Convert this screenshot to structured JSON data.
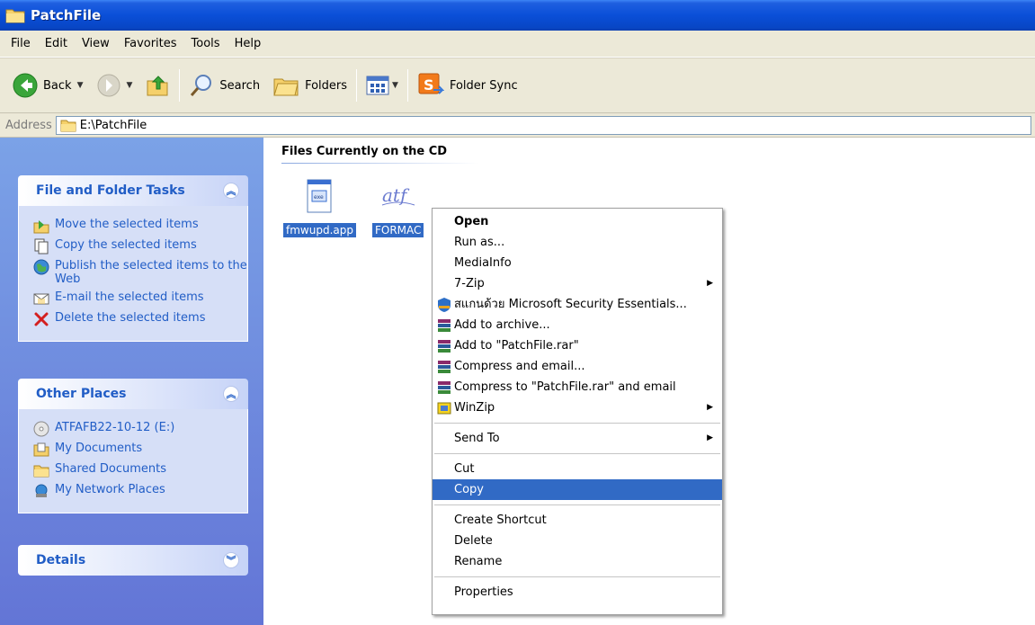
{
  "window": {
    "title": "PatchFile"
  },
  "menubar": {
    "items": [
      "File",
      "Edit",
      "View",
      "Favorites",
      "Tools",
      "Help"
    ]
  },
  "toolbar": {
    "back_label": "Back",
    "search_label": "Search",
    "folders_label": "Folders",
    "folder_sync_label": "Folder Sync"
  },
  "address": {
    "label": "Address",
    "value": "E:\\PatchFile"
  },
  "taskpane": {
    "file_tasks": {
      "title": "File and Folder Tasks",
      "items": [
        "Move the selected items",
        "Copy the selected items",
        "Publish the selected items to the Web",
        "E-mail the selected items",
        "Delete the selected items"
      ]
    },
    "other_places": {
      "title": "Other Places",
      "items": [
        "ATFAFB22-10-12 (E:)",
        "My Documents",
        "Shared Documents",
        "My Network Places"
      ]
    },
    "details": {
      "title": "Details"
    }
  },
  "content": {
    "group_title": "Files Currently on the CD",
    "files": [
      {
        "name": "fmwupd.app",
        "icon": "app-file-icon"
      },
      {
        "name": "FORMAC",
        "icon": "atf-file-icon"
      }
    ]
  },
  "context_menu": {
    "items": [
      {
        "label": "Open",
        "bold": true
      },
      {
        "label": "Run as..."
      },
      {
        "label": "MediaInfo"
      },
      {
        "label": "7-Zip",
        "submenu": true
      },
      {
        "label": "สแกนด้วย Microsoft Security Essentials...",
        "icon": "security-essentials-icon"
      },
      {
        "label": "Add to archive...",
        "icon": "winrar-icon"
      },
      {
        "label": "Add to \"PatchFile.rar\"",
        "icon": "winrar-icon"
      },
      {
        "label": "Compress and email...",
        "icon": "winrar-icon"
      },
      {
        "label": "Compress to \"PatchFile.rar\" and email",
        "icon": "winrar-icon"
      },
      {
        "label": "WinZip",
        "icon": "winzip-icon",
        "submenu": true
      },
      {
        "label": "Send To",
        "submenu": true
      },
      {
        "label": "Cut"
      },
      {
        "label": "Copy",
        "highlighted": true
      },
      {
        "label": "Create Shortcut"
      },
      {
        "label": "Delete"
      },
      {
        "label": "Rename"
      },
      {
        "label": "Properties"
      }
    ]
  },
  "colors": {
    "selection": "#316ac5",
    "title_bar": "#0a4fd8",
    "task_link": "#215dc6"
  }
}
